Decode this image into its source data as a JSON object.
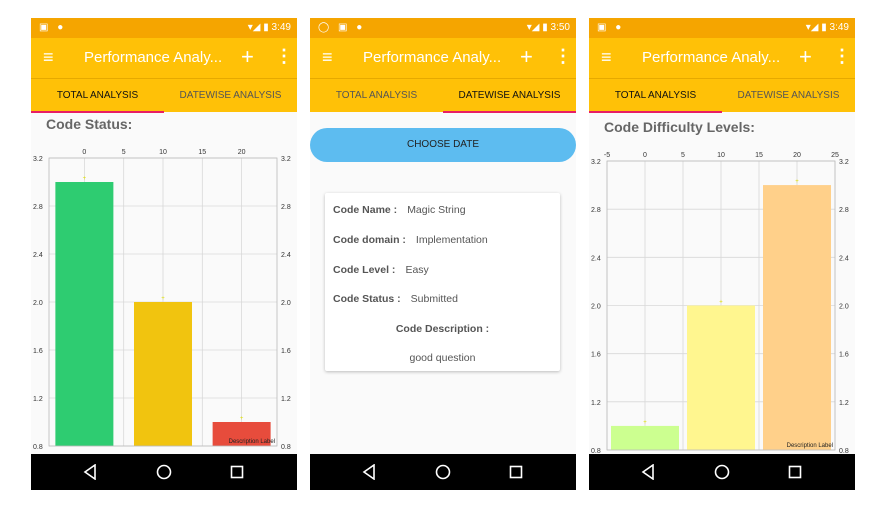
{
  "status_bar": [
    {
      "left_icons": "▣ ●",
      "time": "3:49"
    },
    {
      "left_icons": "◯ ▣ ●",
      "time": "3:50"
    },
    {
      "left_icons": "▣ ●",
      "time": "3:49"
    }
  ],
  "app": {
    "title": "Performance Analy...",
    "add_label": "+",
    "more_label": "⋮",
    "menu_label": "≡"
  },
  "tabs": [
    "TOTAL ANALYSIS",
    "DATEWISE ANALYSIS"
  ],
  "screen1": {
    "section_title": "Code Status:"
  },
  "screen2": {
    "choose_date": "CHOOSE DATE",
    "details": [
      {
        "label": "Code Name :",
        "value": "Magic String"
      },
      {
        "label": "Code domain :",
        "value": "Implementation"
      },
      {
        "label": "Code Level :",
        "value": "Easy"
      },
      {
        "label": "Code Status :",
        "value": "Submitted"
      }
    ],
    "description_label": "Code Description :",
    "description_value": "good question"
  },
  "screen3": {
    "section_title": "Code Difficulty Levels:"
  },
  "chart_data": [
    {
      "type": "bar",
      "x": [
        0,
        10,
        20
      ],
      "values": [
        3.0,
        2.0,
        1.0
      ],
      "colors": [
        "#2ecc71",
        "#f1c40f",
        "#e74c3c"
      ],
      "x_ticks": [
        "0",
        "5",
        "10",
        "15",
        "20"
      ],
      "y_ticks": [
        "3.2",
        "2.8",
        "2.4",
        "2.0",
        "1.6",
        "1.2",
        "0.8"
      ],
      "ylim": [
        0.8,
        3.2
      ],
      "xlim": [
        -4.5,
        24.5
      ],
      "description": "Description Label"
    },
    {
      "type": "bar",
      "x": [
        0,
        10,
        20
      ],
      "values": [
        1.0,
        2.0,
        3.0
      ],
      "colors": [
        "#ccff90",
        "#fff68f",
        "#ffd08a"
      ],
      "x_ticks": [
        "-5",
        "0",
        "5",
        "10",
        "15",
        "20",
        "25"
      ],
      "y_ticks": [
        "3.2",
        "2.8",
        "2.4",
        "2.0",
        "1.6",
        "1.2",
        "0.8"
      ],
      "ylim": [
        0.8,
        3.2
      ],
      "xlim": [
        -5,
        25
      ],
      "description": "Description Label"
    }
  ]
}
